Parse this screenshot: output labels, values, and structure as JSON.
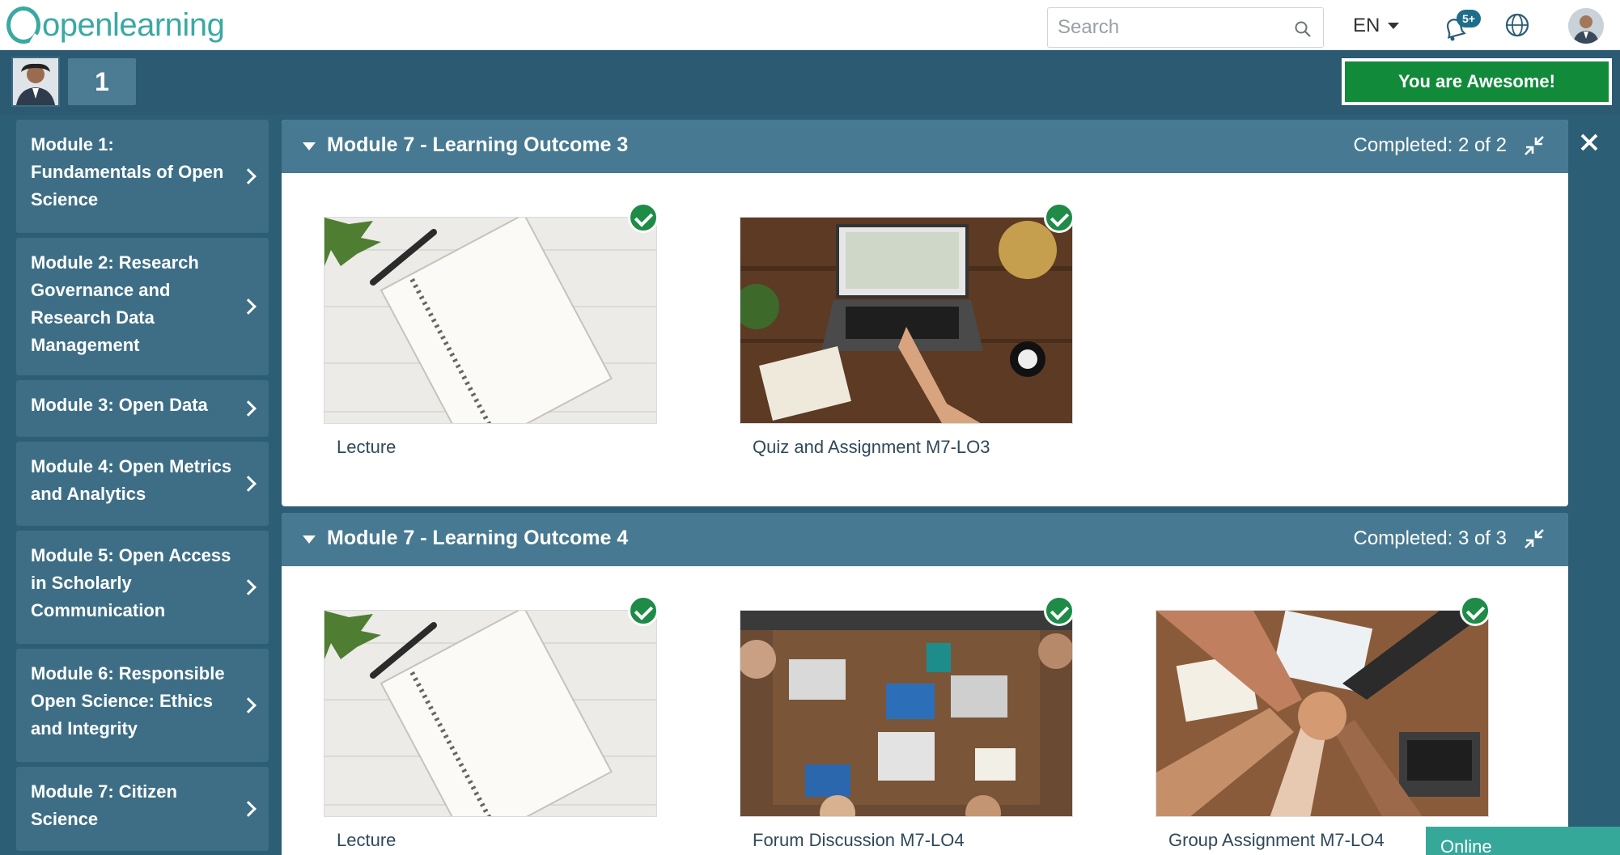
{
  "header": {
    "logo_text": "openlearning",
    "search_placeholder": "Search",
    "language": "EN",
    "notifications_badge": "5+"
  },
  "user": {
    "level": "1",
    "awesome_button": "You are Awesome!"
  },
  "sidebar": {
    "modules": [
      {
        "label": "Module 1: Fundamentals of Open Science"
      },
      {
        "label": "Module 2: Research Governance and Research Data Management"
      },
      {
        "label": "Module 3: Open Data"
      },
      {
        "label": "Module 4: Open Metrics and Analytics"
      },
      {
        "label": "Module 5: Open Access in Scholarly Communication"
      },
      {
        "label": "Module 6: Responsible Open Science: Ethics and Integrity"
      },
      {
        "label": "Module 7: Citizen Science"
      }
    ]
  },
  "sections": [
    {
      "title": "Module 7 - Learning Outcome 3",
      "progress": "Completed: 2 of 2",
      "items": [
        {
          "label": "Lecture",
          "thumb": "notebook",
          "completed": true
        },
        {
          "label": "Quiz and Assignment M7-LO3",
          "thumb": "laptop-desk",
          "completed": true
        }
      ]
    },
    {
      "title": "Module 7 - Learning Outcome 4",
      "progress": "Completed: 3 of 3",
      "items": [
        {
          "label": "Lecture",
          "thumb": "notebook",
          "completed": true
        },
        {
          "label": "Forum Discussion M7-LO4",
          "thumb": "team-table",
          "completed": true
        },
        {
          "label": "Group Assignment M7-LO4",
          "thumb": "hands-together",
          "completed": true
        }
      ]
    }
  ],
  "status": {
    "online_label": "Online"
  },
  "colors": {
    "brand_teal": "#3aa9a2",
    "dark_band": "#2c5e76",
    "section_header": "#477a92",
    "success_green": "#118a3a"
  }
}
